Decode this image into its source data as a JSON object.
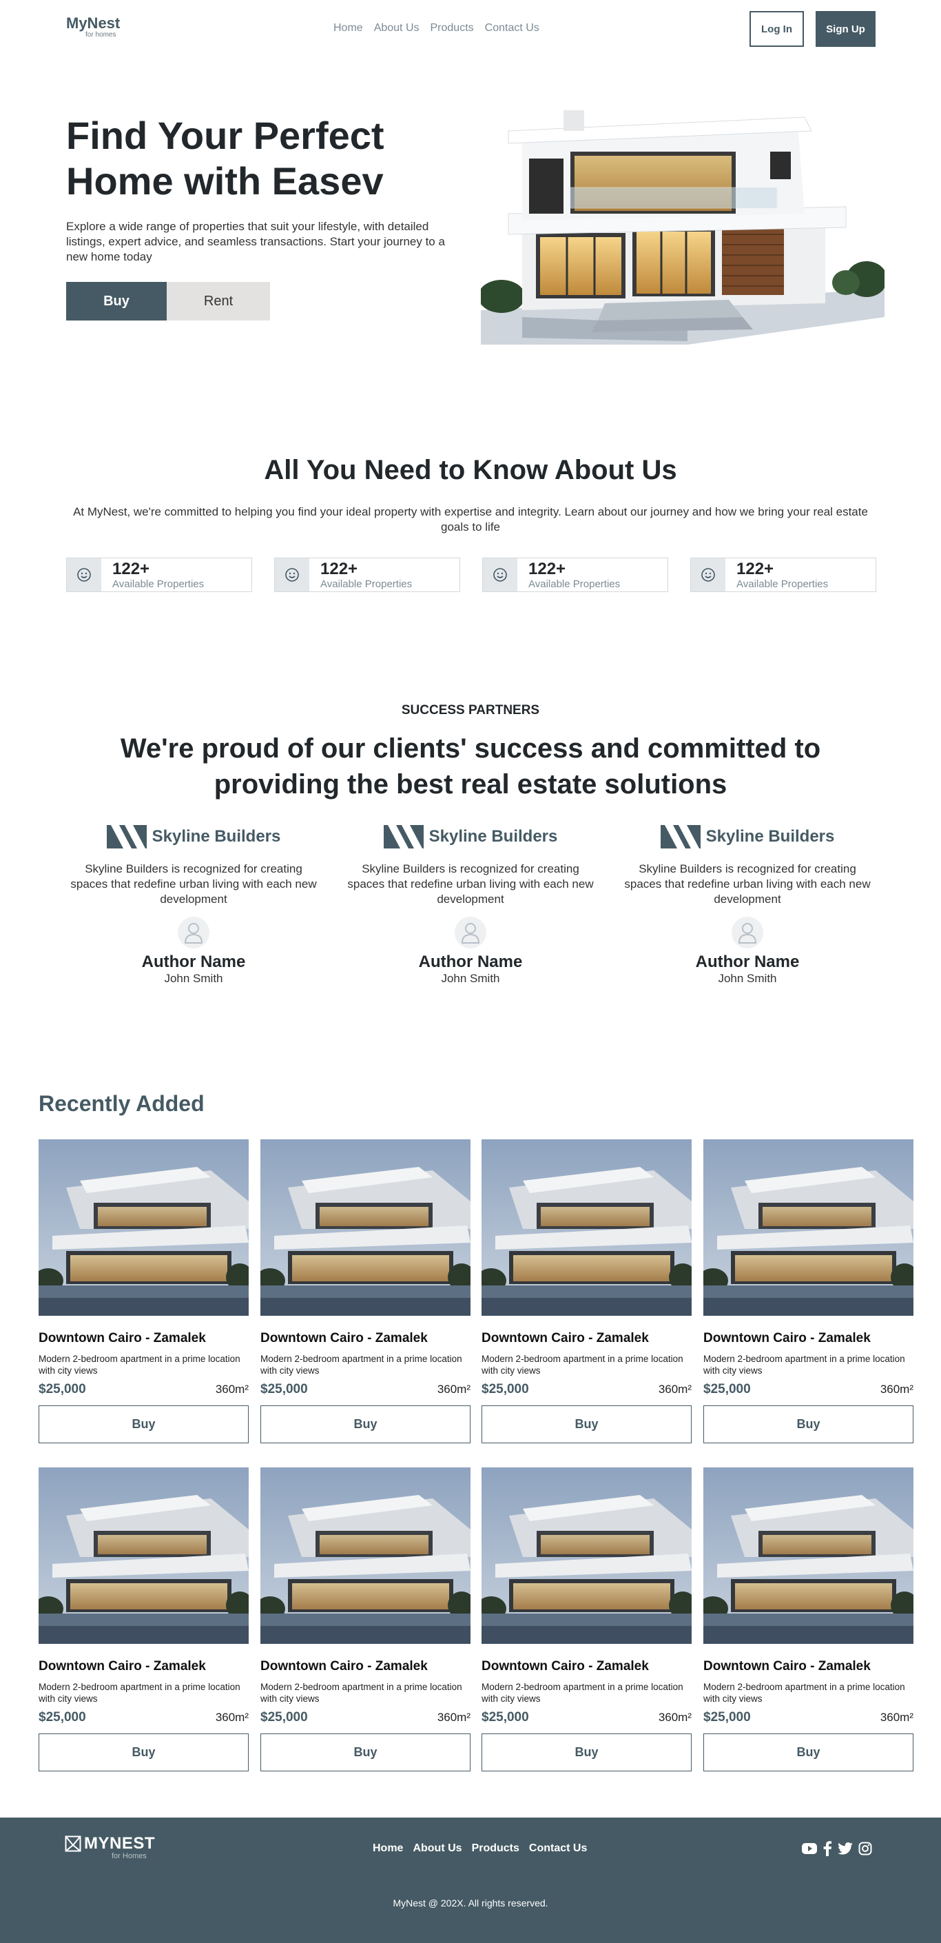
{
  "header": {
    "logo_name": "MyNest",
    "logo_tag": "for homes",
    "nav": [
      "Home",
      "About Us",
      "Products",
      "Contact Us"
    ],
    "login": "Log In",
    "signup": "Sign Up"
  },
  "hero": {
    "title": "Find Your Perfect Home with Easev",
    "description": "Explore a wide range of properties that suit your lifestyle, with detailed listings, expert advice, and seamless transactions. Start your journey to a new home today",
    "buy": "Buy",
    "rent": "Rent"
  },
  "about": {
    "title": "All You Need to Know About Us",
    "description": "At MyNest, we're committed to helping you find your ideal property with expertise and integrity. Learn about our journey and how we bring your real estate goals to life",
    "stats": [
      {
        "value": "122+",
        "label": "Available Properties",
        "icon": "smiley-icon"
      },
      {
        "value": "122+",
        "label": "Available Properties",
        "icon": "smiley-icon"
      },
      {
        "value": "122+",
        "label": "Available Properties",
        "icon": "smiley-icon"
      },
      {
        "value": "122+",
        "label": "Available Properties",
        "icon": "smiley-icon"
      }
    ]
  },
  "partners": {
    "kicker": "SUCCESS PARTNERS",
    "title": "We're proud of our clients' success and committed to providing the best real estate solutions",
    "items": [
      {
        "brand": "Skyline Builders",
        "description": "Skyline Builders is recognized for creating spaces that redefine urban living with each new development",
        "author_label": "Author Name",
        "author": "John Smith"
      },
      {
        "brand": "Skyline Builders",
        "description": "Skyline Builders is recognized for creating spaces that redefine urban living with each new development",
        "author_label": "Author Name",
        "author": "John Smith"
      },
      {
        "brand": "Skyline Builders",
        "description": "Skyline Builders is recognized for creating spaces that redefine urban living with each new development",
        "author_label": "Author Name",
        "author": "John Smith"
      }
    ]
  },
  "recent": {
    "title": "Recently Added",
    "cards": [
      {
        "title": "Downtown Cairo - Zamalek",
        "description": "Modern 2-bedroom apartment in a prime location with city views",
        "price": "$25,000",
        "area": "360m²",
        "button": "Buy"
      },
      {
        "title": "Downtown Cairo - Zamalek",
        "description": "Modern 2-bedroom apartment in a prime location with city views",
        "price": "$25,000",
        "area": "360m²",
        "button": "Buy"
      },
      {
        "title": "Downtown Cairo - Zamalek",
        "description": "Modern 2-bedroom apartment in a prime location with city views",
        "price": "$25,000",
        "area": "360m²",
        "button": "Buy"
      },
      {
        "title": "Downtown Cairo - Zamalek",
        "description": "Modern 2-bedroom apartment in a prime location with city views",
        "price": "$25,000",
        "area": "360m²",
        "button": "Buy"
      },
      {
        "title": "Downtown Cairo - Zamalek",
        "description": "Modern 2-bedroom apartment in a prime location with city views",
        "price": "$25,000",
        "area": "360m²",
        "button": "Buy"
      },
      {
        "title": "Downtown Cairo - Zamalek",
        "description": "Modern 2-bedroom apartment in a prime location with city views",
        "price": "$25,000",
        "area": "360m²",
        "button": "Buy"
      },
      {
        "title": "Downtown Cairo - Zamalek",
        "description": "Modern 2-bedroom apartment in a prime location with city views",
        "price": "$25,000",
        "area": "360m²",
        "button": "Buy"
      },
      {
        "title": "Downtown Cairo - Zamalek",
        "description": "Modern 2-bedroom apartment in a prime location with city views",
        "price": "$25,000",
        "area": "360m²",
        "button": "Buy"
      }
    ]
  },
  "footer": {
    "logo_name": "MYNEST",
    "logo_tag": "for Homes",
    "nav": [
      "Home",
      "About Us",
      "Products",
      "Contact Us"
    ],
    "social_icons": [
      "youtube-icon",
      "facebook-icon",
      "twitter-icon",
      "instagram-icon"
    ],
    "copyright": "MyNest @ 202X. All rights reserved."
  },
  "colors": {
    "primary": "#455a64",
    "light": "#e4e2e0",
    "text": "#22272b"
  }
}
